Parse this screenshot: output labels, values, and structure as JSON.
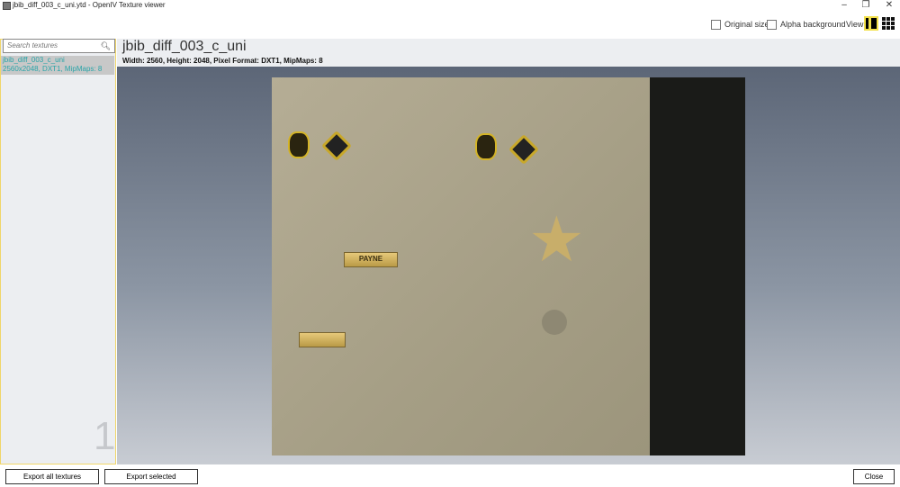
{
  "window": {
    "title": "jbib_diff_003_c_uni.ytd - OpenIV Texture viewer",
    "minimize": "–",
    "restore": "❐",
    "close": "✕"
  },
  "toolbar": {
    "original_size": "Original size",
    "alpha_background": "Alpha background",
    "view_label": "View:",
    "original_size_checked": false,
    "alpha_background_checked": false
  },
  "sidebar": {
    "search_placeholder": "Search textures",
    "items": [
      {
        "name": "jbib_diff_003_c_uni",
        "info": "2560x2048, DXT1, MipMaps: 8"
      }
    ],
    "count": "1"
  },
  "main": {
    "texture_name": "jbib_diff_003_c_uni",
    "texture_info": "Width: 2560, Height: 2048, Pixel Format: DXT1, MipMaps: 8",
    "nameplate": "PAYNE"
  },
  "footer": {
    "export_all": "Export all textures",
    "export_selected": "Export selected",
    "close": "Close"
  },
  "colors": {
    "accent": "#f2e04a",
    "list_text": "#29a4a8"
  }
}
